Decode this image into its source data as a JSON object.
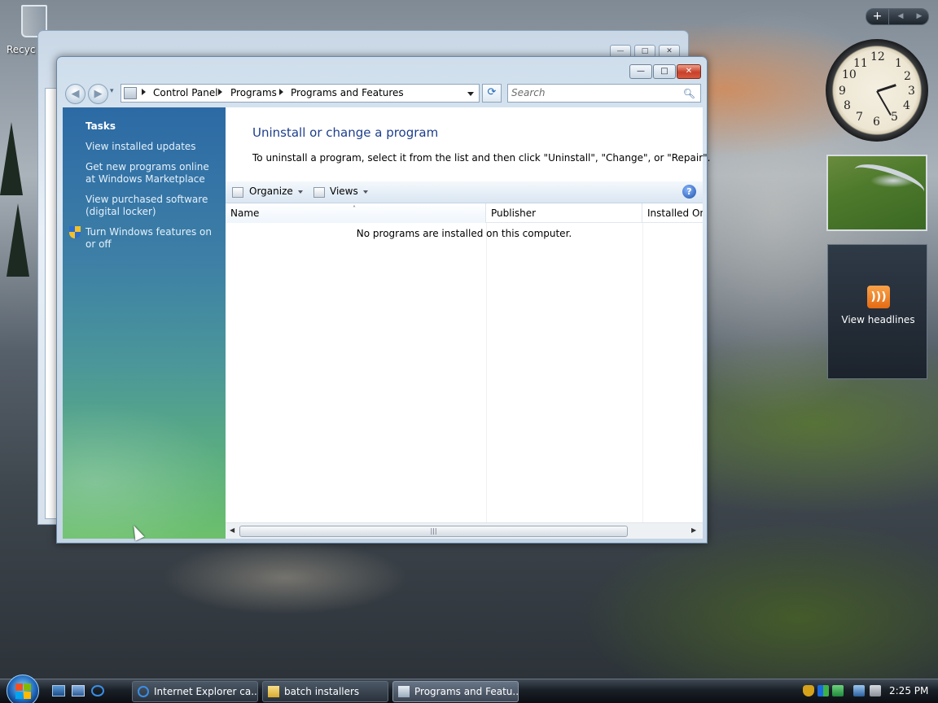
{
  "desktop": {
    "recycle_bin_label": "Recyc"
  },
  "window": {
    "title": "Programs and Features",
    "controls": {
      "minimize": "—",
      "maximize": "□",
      "close": "✕"
    },
    "nav": {
      "back": "◀",
      "forward": "▶",
      "history_dropdown": "▾"
    },
    "breadcrumb": [
      "Control Panel",
      "Programs",
      "Programs and Features"
    ],
    "refresh": "⟳",
    "search": {
      "placeholder": "Search",
      "value": "",
      "icon": "search-icon"
    }
  },
  "left_pane": {
    "heading": "Tasks",
    "links": [
      "View installed updates",
      "Get new programs online at Windows Marketplace",
      "View purchased software (digital locker)",
      "Turn Windows features on or off"
    ]
  },
  "content": {
    "title": "Uninstall or change a program",
    "description": "To uninstall a program, select it from the list and then click \"Uninstall\", \"Change\", or \"Repair\".",
    "toolbar": {
      "organize": "Organize",
      "views": "Views",
      "help": "?"
    },
    "columns": [
      "Name",
      "Publisher",
      "Installed On"
    ],
    "sort_arrow": "˄",
    "empty_message": "No programs are installed on this computer.",
    "hscroll": {
      "left": "◀",
      "right": "▶",
      "grip": "|||"
    }
  },
  "sidebar": {
    "controls": {
      "add": "+",
      "prev": "◀",
      "next": "▶"
    },
    "clock_numbers": [
      "12",
      "1",
      "2",
      "3",
      "4",
      "5",
      "6",
      "7",
      "8",
      "9",
      "10",
      "11"
    ],
    "feed_label": "View headlines",
    "feed_icon": "rss-icon"
  },
  "taskbar": {
    "tasks": [
      "Internet Explorer ca...",
      "batch installers",
      "Programs and Featu..."
    ],
    "active_task": "Programs and Featu...",
    "time": "2:25 PM"
  },
  "colors": {
    "title_link": "#1e3e8c",
    "left_pane_top": "#2c6aa5",
    "left_pane_bottom": "#6cc06c",
    "close_button": "#c8402a"
  }
}
